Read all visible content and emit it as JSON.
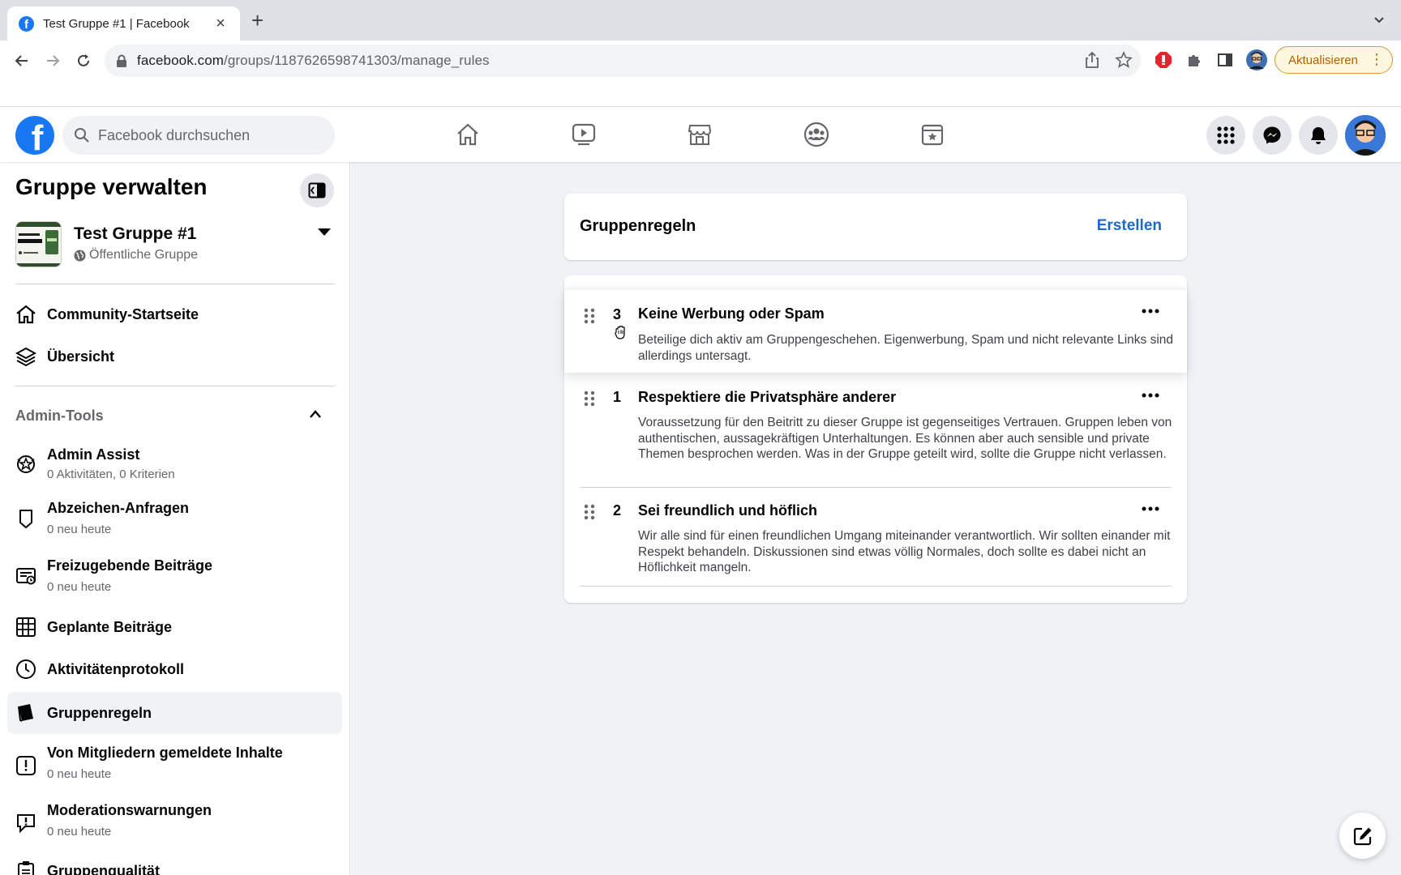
{
  "browser": {
    "tab_title": "Test Gruppe #1 | Facebook",
    "url_host": "facebook.com",
    "url_path": "/groups/1187626598741303/manage_rules",
    "update_label": "Aktualisieren"
  },
  "fb": {
    "search_placeholder": "Facebook durchsuchen"
  },
  "sidebar": {
    "title": "Gruppe verwalten",
    "group_name": "Test Gruppe #1",
    "group_privacy": "Öffentliche Gruppe",
    "nav": [
      {
        "label": "Community-Startseite"
      },
      {
        "label": "Übersicht"
      }
    ],
    "admin_tools_label": "Admin-Tools",
    "tools": [
      {
        "label": "Admin Assist",
        "sub": "0 Aktivitäten, 0 Kriterien"
      },
      {
        "label": "Abzeichen-Anfragen",
        "sub": "0 neu heute"
      },
      {
        "label": "Freizugebende Beiträge",
        "sub": "0 neu heute"
      },
      {
        "label": "Geplante Beiträge"
      },
      {
        "label": "Aktivitätenprotokoll"
      },
      {
        "label": "Gruppenregeln"
      },
      {
        "label": "Von Mitgliedern gemeldete Inhalte",
        "sub": "0 neu heute"
      },
      {
        "label": "Moderationswarnungen",
        "sub": "0 neu heute"
      },
      {
        "label": "Gruppenqualität"
      }
    ]
  },
  "main": {
    "header_title": "Gruppenregeln",
    "create_label": "Erstellen",
    "rules": [
      {
        "number": "3",
        "title": "Keine Werbung oder Spam",
        "text": "Beteilige dich aktiv am Gruppengeschehen. Eigenwerbung, Spam und nicht relevante Links sind allerdings untersagt."
      },
      {
        "number": "1",
        "title": "Respektiere die Privatsphäre anderer",
        "text": "Voraussetzung für den Beitritt zu dieser Gruppe ist gegenseitiges Vertrauen. Gruppen leben von authentischen, aussagekräftigen Unterhaltungen. Es können aber auch sensible und private Themen besprochen werden. Was in der Gruppe geteilt wird, sollte die Gruppe nicht verlassen."
      },
      {
        "number": "2",
        "title": "Sei freundlich und höflich",
        "text": "Wir alle sind für einen freundlichen Umgang miteinander verantwortlich. Wir sollten einander mit Respekt behandeln. Diskussionen sind etwas völlig Normales, doch sollte es dabei nicht an Höflichkeit mangeln."
      }
    ]
  },
  "colors": {
    "facebook_blue": "#1877f2",
    "link_blue": "#1b6ac9",
    "page_bg": "#f0f2f5",
    "update_orange": "#b06000"
  },
  "icons": [
    "facebook-logo",
    "search-icon",
    "home-icon",
    "watch-icon",
    "marketplace-icon",
    "groups-icon",
    "gaming-icon",
    "menu-grid-icon",
    "messenger-icon",
    "bell-icon",
    "drag-handle-icon",
    "more-icon",
    "compose-icon"
  ]
}
